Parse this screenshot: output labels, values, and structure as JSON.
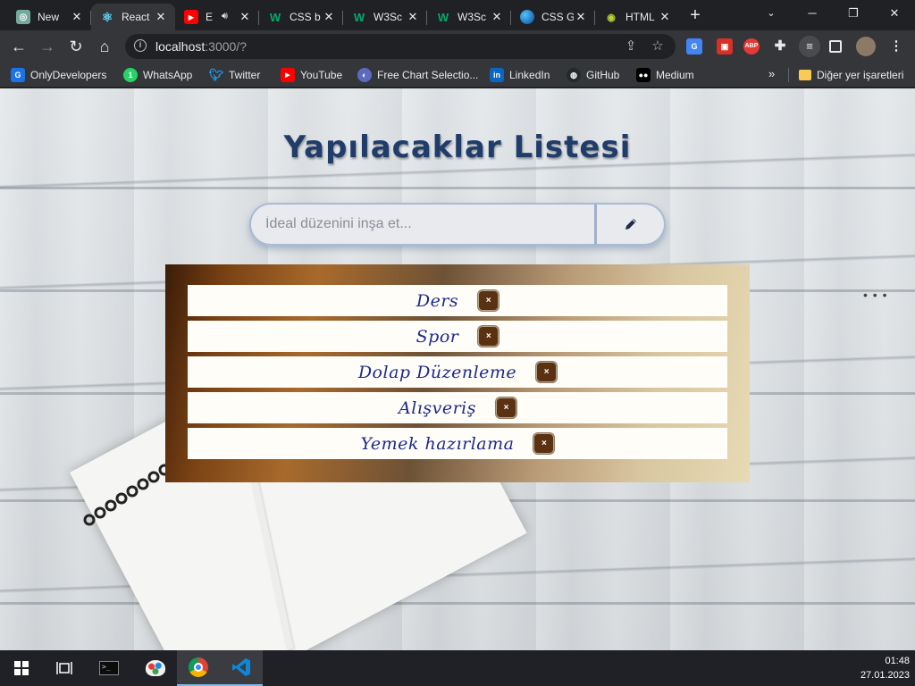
{
  "browser": {
    "tabs": [
      {
        "label": "New",
        "icon": "chatgpt-icon",
        "active": false
      },
      {
        "label": "React",
        "icon": "react-icon",
        "active": true
      },
      {
        "label": "E",
        "icon": "youtube-icon",
        "active": false,
        "audio": true
      },
      {
        "label": "CSS b",
        "icon": "w3schools-icon",
        "active": false
      },
      {
        "label": "W3Sc",
        "icon": "w3schools-icon",
        "active": false
      },
      {
        "label": "W3Sc",
        "icon": "w3schools-icon",
        "active": false
      },
      {
        "label": "CSS G",
        "icon": "globe-icon",
        "active": false
      },
      {
        "label": "HTML",
        "icon": "html-icon",
        "active": false
      }
    ],
    "address": {
      "host": "localhost",
      "rest": ":3000/?"
    },
    "bookmarks": [
      {
        "label": "OnlyDevelopers",
        "icon": "onlydevelopers-icon",
        "color": "#1a73e8"
      },
      {
        "label": "WhatsApp",
        "icon": "whatsapp-icon",
        "color": "#25d366"
      },
      {
        "label": "Twitter",
        "icon": "twitter-icon",
        "color": "#1da1f2"
      },
      {
        "label": "YouTube",
        "icon": "youtube-icon",
        "color": "#ff0000"
      },
      {
        "label": "Free Chart Selectio...",
        "icon": "chart-icon",
        "color": "#5c6bc0"
      },
      {
        "label": "LinkedIn",
        "icon": "linkedin-icon",
        "color": "#0a66c2"
      },
      {
        "label": "GitHub",
        "icon": "github-icon",
        "color": "#24292e"
      },
      {
        "label": "Medium",
        "icon": "medium-icon",
        "color": "#000000"
      }
    ],
    "other_bookmarks": "Diğer yer işaretleri",
    "more_bookmarks": "»"
  },
  "app": {
    "title": "Yapılacaklar Listesi",
    "input": {
      "placeholder": "İdeal düzenini inşa et...",
      "value": ""
    },
    "todos": [
      {
        "text": "Ders",
        "delete_label": "×"
      },
      {
        "text": "Spor",
        "delete_label": "×"
      },
      {
        "text": "Dolap Düzenleme",
        "delete_label": "×"
      },
      {
        "text": "Alışveriş",
        "delete_label": "×"
      },
      {
        "text": "Yemek hazırlama",
        "delete_label": "×"
      }
    ],
    "colors": {
      "title": "#1f3c6b",
      "todo_text": "#1d2a8a",
      "delete_bg": "#5a3212"
    }
  },
  "taskbar": {
    "time": "01:48",
    "date": "27.01.2023",
    "items": [
      "windows-start-icon",
      "task-view-icon",
      "terminal-icon",
      "paint-icon",
      "chrome-icon",
      "vscode-icon"
    ]
  }
}
